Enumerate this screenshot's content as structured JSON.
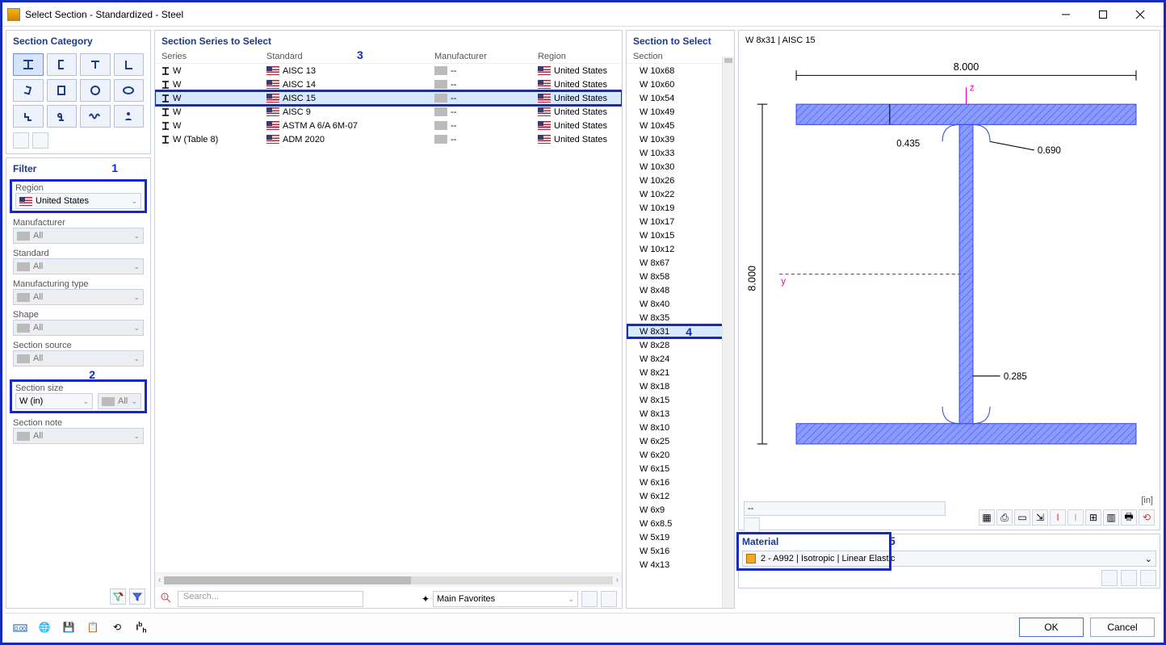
{
  "window": {
    "title": "Select Section - Standardized - Steel"
  },
  "annotations": {
    "n1": "1",
    "n2": "2",
    "n3": "3",
    "n4": "4",
    "n5": "5"
  },
  "category": {
    "header": "Section Category"
  },
  "filter": {
    "header": "Filter",
    "region_label": "Region",
    "region_value": "United States",
    "manuf_label": "Manufacturer",
    "manuf_value": "All",
    "standard_label": "Standard",
    "standard_value": "All",
    "mtype_label": "Manufacturing type",
    "mtype_value": "All",
    "shape_label": "Shape",
    "shape_value": "All",
    "source_label": "Section source",
    "source_value": "All",
    "size_label": "Section size",
    "size_value": "W (in)",
    "size_all": "All",
    "note_label": "Section note",
    "note_value": "All"
  },
  "series": {
    "header": "Section Series to Select",
    "cols": {
      "c1": "Series",
      "c2": "Standard",
      "c3": "Manufacturer",
      "c4": "Region"
    },
    "rows": [
      {
        "s": "W",
        "std": "AISC 13",
        "m": "--",
        "r": "United States"
      },
      {
        "s": "W",
        "std": "AISC 14",
        "m": "--",
        "r": "United States"
      },
      {
        "s": "W",
        "std": "AISC 15",
        "m": "--",
        "r": "United States",
        "sel": true
      },
      {
        "s": "W",
        "std": "AISC 9",
        "m": "--",
        "r": "United States"
      },
      {
        "s": "W",
        "std": "ASTM A 6/A 6M-07",
        "m": "--",
        "r": "United States"
      },
      {
        "s": "W (Table 8)",
        "std": "ADM 2020",
        "m": "--",
        "r": "United States"
      }
    ]
  },
  "sections": {
    "header": "Section to Select",
    "col": "Section",
    "items": [
      "W 10x68",
      "W 10x60",
      "W 10x54",
      "W 10x49",
      "W 10x45",
      "W 10x39",
      "W 10x33",
      "W 10x30",
      "W 10x26",
      "W 10x22",
      "W 10x19",
      "W 10x17",
      "W 10x15",
      "W 10x12",
      "W 8x67",
      "W 8x58",
      "W 8x48",
      "W 8x40",
      "W 8x35",
      "W 8x31",
      "W 8x28",
      "W 8x24",
      "W 8x21",
      "W 8x18",
      "W 8x15",
      "W 8x13",
      "W 8x10",
      "W 6x25",
      "W 6x20",
      "W 6x15",
      "W 6x16",
      "W 6x12",
      "W 6x9",
      "W 6x8.5",
      "W 5x19",
      "W 5x16",
      "W 4x13"
    ],
    "selected": "W 8x31"
  },
  "preview": {
    "title": "W 8x31 | AISC 15",
    "unit": "[in]",
    "dims": {
      "width": "8.000",
      "height": "8.000",
      "tf": "0.435",
      "tw": "0.285",
      "r": "0.690",
      "z": "z",
      "y": "y"
    },
    "dd": "--"
  },
  "material": {
    "header": "Material",
    "value": "2 - A992 | Isotropic | Linear Elastic"
  },
  "search": {
    "placeholder": "Search...",
    "fav": "Main Favorites"
  },
  "buttons": {
    "ok": "OK",
    "cancel": "Cancel"
  }
}
